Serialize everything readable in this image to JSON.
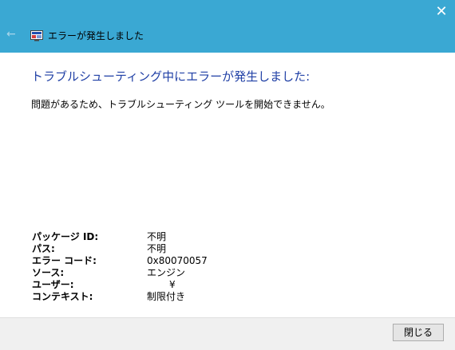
{
  "window": {
    "title": "エラーが発生しました",
    "close_glyph": "✕",
    "back_glyph": "←",
    "titlebar_color": "#3aa8d3"
  },
  "content": {
    "heading": "トラブルシューティング中にエラーが発生しました:",
    "message": "問題があるため、トラブルシューティング ツールを開始できません。",
    "details": [
      {
        "label": "パッケージ ID:",
        "value": "不明"
      },
      {
        "label": "パス:",
        "value": "不明"
      },
      {
        "label": "エラー コード:",
        "value": "0x80070057"
      },
      {
        "label": "ソース:",
        "value": "エンジン"
      },
      {
        "label": "ユーザー:",
        "value": "¥"
      },
      {
        "label": "コンテキスト:",
        "value": "制限付き"
      }
    ]
  },
  "footer": {
    "close_button_label": "閉じる"
  }
}
